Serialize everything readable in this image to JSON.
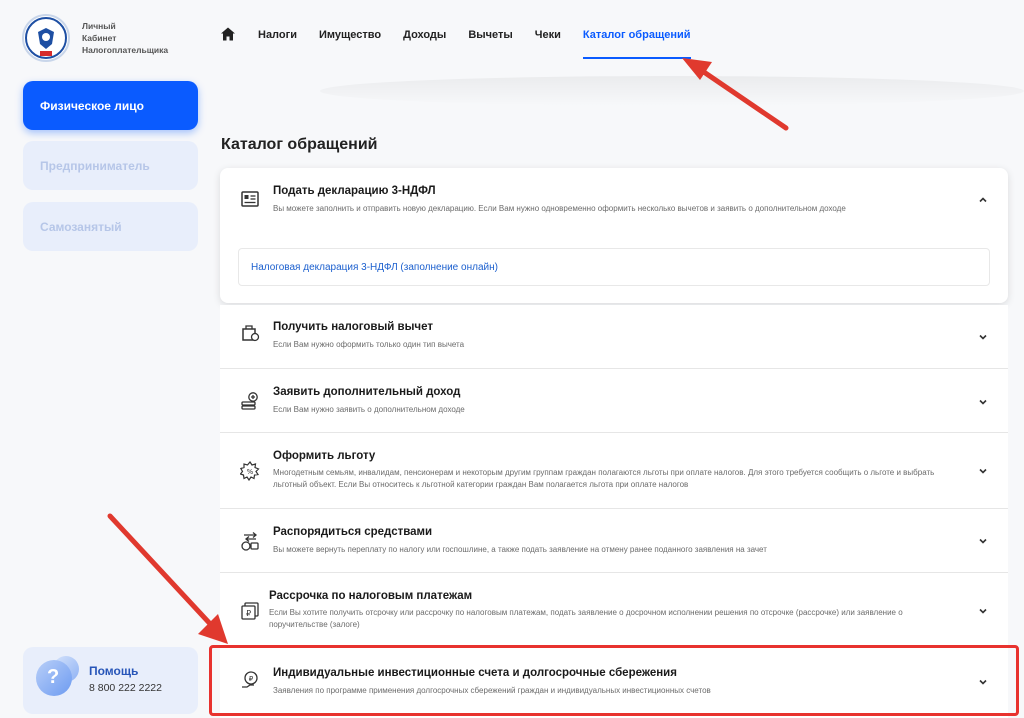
{
  "logo": {
    "line1": "Личный",
    "line2": "Кабинет",
    "line3": "Налогоплательщика"
  },
  "roles": [
    {
      "label": "Физическое лицо",
      "active": true
    },
    {
      "label": "Предприниматель",
      "active": false
    },
    {
      "label": "Самозанятый",
      "active": false
    }
  ],
  "help": {
    "title": "Помощь",
    "phone": "8 800 222 2222"
  },
  "nav": {
    "items": [
      "Налоги",
      "Имущество",
      "Доходы",
      "Вычеты",
      "Чеки",
      "Каталог обращений"
    ],
    "active": "Каталог обращений"
  },
  "page": {
    "title": "Каталог обращений"
  },
  "catalog": [
    {
      "icon": "declaration-icon",
      "title": "Подать декларацию 3-НДФЛ",
      "desc": "Вы можете заполнить и отправить новую декларацию. Если Вам нужно одновременно оформить несколько вычетов и заявить о дополнительном доходе",
      "expanded": true,
      "link": "Налоговая декларация 3-НДФЛ (заполнение онлайн)"
    },
    {
      "icon": "wallet-icon",
      "title": "Получить налоговый вычет",
      "desc": "Если Вам нужно оформить только один тип вычета"
    },
    {
      "icon": "coins-plus-icon",
      "title": "Заявить дополнительный доход",
      "desc": "Если Вам нужно заявить о дополнительном доходе"
    },
    {
      "icon": "benefit-icon",
      "title": "Оформить льготу",
      "desc": "Многодетным семьям, инвалидам, пенсионерам и некоторым другим группам граждан полагаются льготы при оплате налогов. Для этого требуется сообщить о льготе и выбрать льготный объект. Если Вы относитесь к льготной категории граждан Вам полагается льгота при оплате налогов"
    },
    {
      "icon": "transfer-icon",
      "title": "Распорядиться средствами",
      "desc": "Вы можете вернуть переплату по налогу или госпошлине, а также подать заявление на отмену ранее поданного заявления на зачет"
    },
    {
      "icon": "installment-icon",
      "title": "Рассрочка по налоговым платежам",
      "desc": "Если Вы хотите получить отсрочку или рассрочку по налоговым платежам, подать заявление о досрочном исполнении решения по отсрочке (рассрочке) или заявление о поручительстве (залоге)"
    },
    {
      "icon": "investment-icon",
      "title": "Индивидуальные инвестиционные счета и долгосрочные сбережения",
      "desc": "Заявления по программе применения долгосрочных сбережений граждан и индивидуальных инвестиционных счетов"
    }
  ],
  "colors": {
    "accent": "#0a5bff",
    "highlight": "#e8322e",
    "arrow": "#e0392e"
  }
}
